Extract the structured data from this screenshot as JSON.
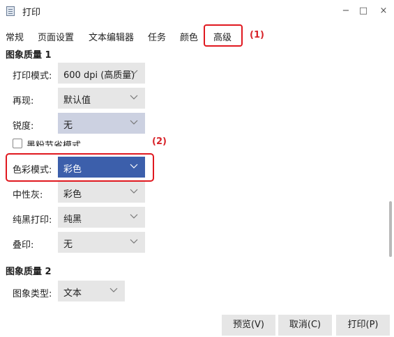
{
  "window": {
    "title": "打印",
    "minimize_glyph": "−",
    "maximize_glyph": "□",
    "close_glyph": "×"
  },
  "tabs": [
    "常规",
    "页面设置",
    "文本编辑器",
    "任务",
    "颜色",
    "高级"
  ],
  "active_tab": "高级",
  "annotations": {
    "tab": "(1)",
    "color_mode": "(2)"
  },
  "section1": {
    "title": "图象质量 1",
    "rows": [
      {
        "label": "打印模式:",
        "value": "600 dpi (高质量)"
      },
      {
        "label": "再现:",
        "value": "默认值"
      },
      {
        "label": "锐度:",
        "value": "无"
      }
    ],
    "checkbox_label": "墨粉节省模式",
    "color_mode": {
      "label": "色彩模式:",
      "value": "彩色"
    },
    "rows2": [
      {
        "label": "中性灰:",
        "value": "彩色"
      },
      {
        "label": "纯黑打印:",
        "value": "纯黑"
      },
      {
        "label": "叠印:",
        "value": "无"
      }
    ]
  },
  "section2": {
    "title": "图象质量 2",
    "rows": [
      {
        "label": "图象类型:",
        "value": "文本"
      }
    ]
  },
  "buttons": {
    "preview": "预览(V)",
    "cancel": "取消(C)",
    "print": "打印(P)"
  },
  "colors": {
    "highlight": "#e0181f",
    "selected_select": "#3c5fab",
    "select_bg": "#e6e6e6"
  }
}
